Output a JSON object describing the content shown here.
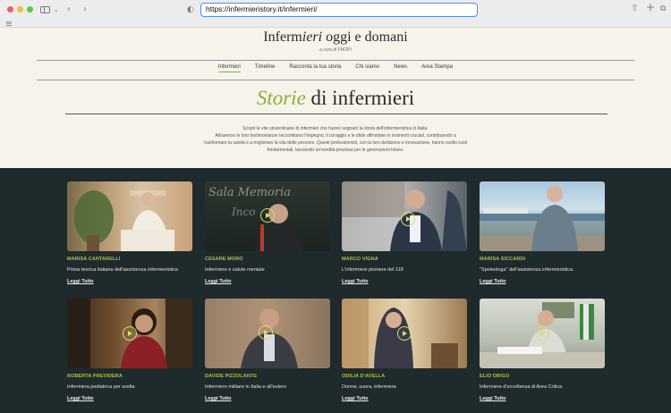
{
  "browser": {
    "url": "https://infermieristory.it/infermieri/"
  },
  "site": {
    "logo_part1": "Inferm",
    "logo_italic": "ieri",
    "logo_part2": " oggi e domani",
    "logo_sub": "a cura di FNOPI"
  },
  "nav": {
    "items": [
      {
        "label": "Infermieri"
      },
      {
        "label": "Timeline"
      },
      {
        "label": "Racconta la tua storia"
      },
      {
        "label": "Chi siamo"
      },
      {
        "label": "News"
      },
      {
        "label": "Area Stampa"
      }
    ]
  },
  "page": {
    "title_italic": "Storie",
    "title_rest": " di infermieri",
    "intro_lines": [
      "Scopri le vite straordinarie di infermieri che hanno segnato la storia dell'infermieristica in Italia.",
      "Attraverso le loro testimonianze raccontiamo l'impegno, il coraggio e le sfide affrontate in momenti cruciali, contribuendo a",
      "trasformare la sanità e a migliorare la vita delle persone. Questi professionisti, con la loro dedizione e innovazione, hanno svolto ruoli",
      "fondamentali, lasciando un'eredità preziosa per le generazioni future."
    ]
  },
  "cards": [
    {
      "name": "MARISA CANTARELLI",
      "desc": "Prima teorica italiana dell'assistenza infermieristica",
      "link": "Leggi Tutto"
    },
    {
      "name": "CESARE MORO",
      "desc": "Infermiere e salute mentale",
      "link": "Leggi Tutto"
    },
    {
      "name": "MARCO VIGNA",
      "desc": "L'infermiere pioniere del 118",
      "link": "Leggi Tutto"
    },
    {
      "name": "MARISA SICCARDI",
      "desc": "\"Speleologa\" dell'assistenza infermieristica",
      "link": "Leggi Tutto"
    },
    {
      "name": "ROBERTA PREVIDERA",
      "desc": "Infermiera pediatrica per scelta",
      "link": "Leggi Tutto"
    },
    {
      "name": "DAVIDE PIZZOLANTE",
      "desc": "Infermiere militare in Italia e all'estero",
      "link": "Leggi Tutto"
    },
    {
      "name": "ODILIA D'AVELLA",
      "desc": "Donna, suora, infermiera",
      "link": "Leggi Tutto"
    },
    {
      "name": "ELIO DRIGO",
      "desc": "Infermiere d'eccellenza di Area Critica",
      "link": "Leggi Tutto"
    }
  ],
  "colors": {
    "accent": "#8aae36",
    "gallery_bg": "#1f2a2d"
  }
}
